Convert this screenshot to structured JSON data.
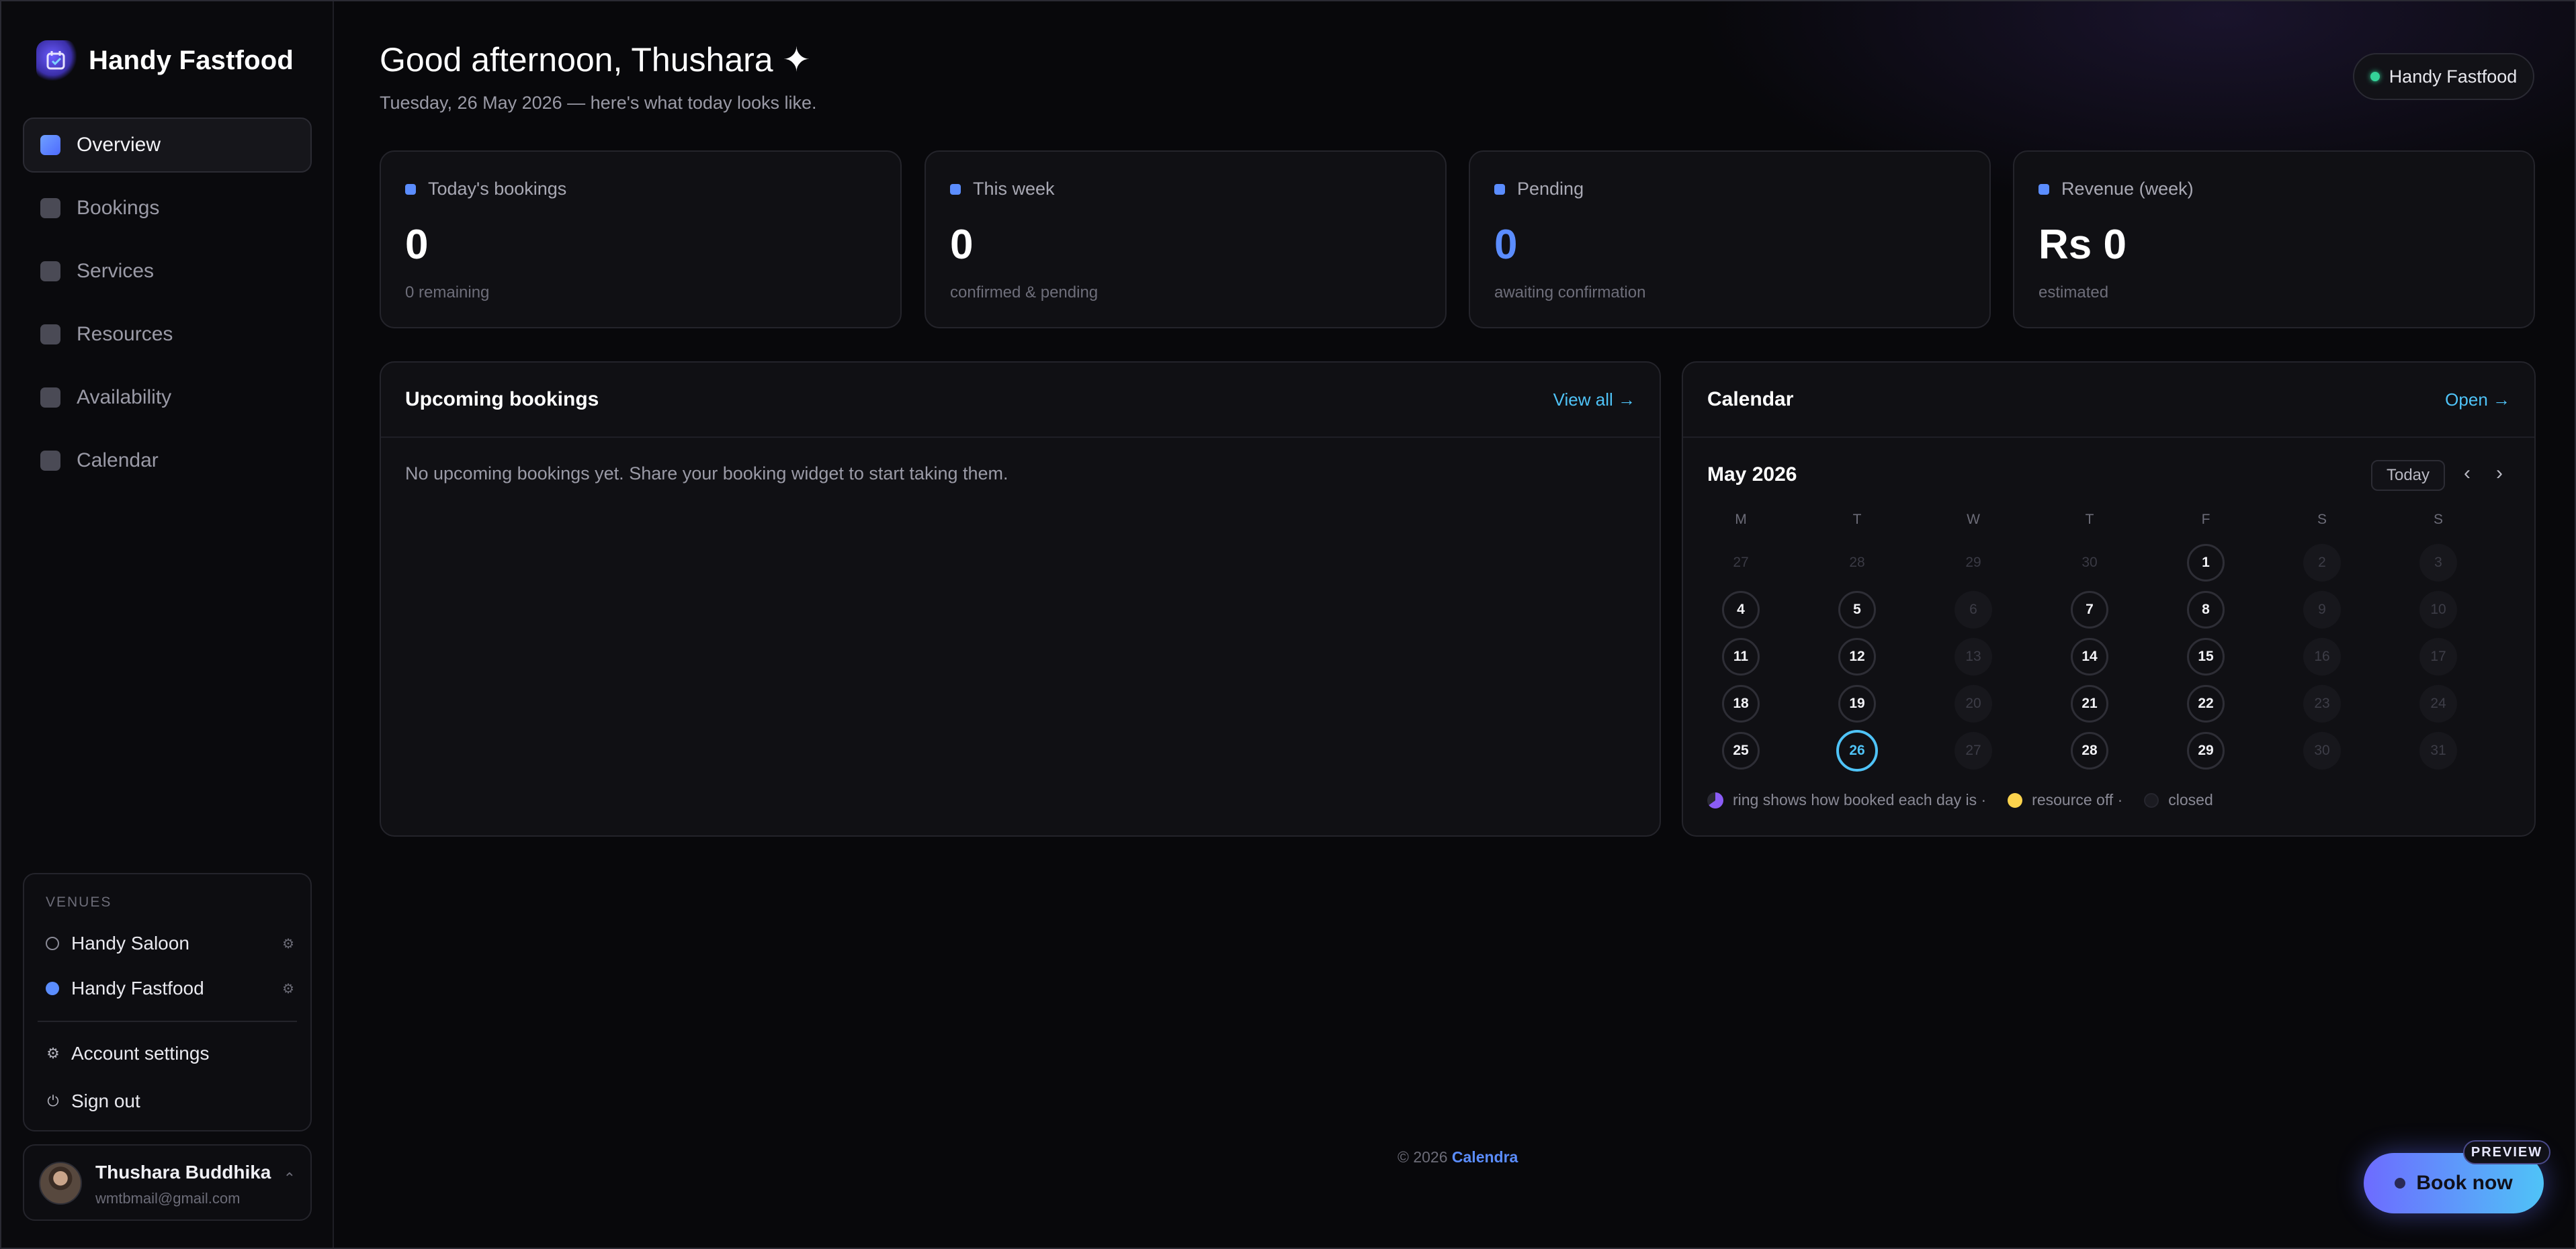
{
  "sidebar": {
    "brand": "Handy Fastfood",
    "nav": [
      {
        "label": "Overview"
      },
      {
        "label": "Bookings"
      },
      {
        "label": "Services"
      },
      {
        "label": "Resources"
      },
      {
        "label": "Availability"
      },
      {
        "label": "Calendar"
      }
    ],
    "venues_title": "VENUES",
    "venues": [
      {
        "label": "Handy Saloon"
      },
      {
        "label": "Handy Fastfood"
      }
    ],
    "account_settings": "Account settings",
    "sign_out": "Sign out",
    "user": {
      "name": "Thushara Buddhika",
      "email": "wmtbmail@gmail.com"
    }
  },
  "header": {
    "greeting": "Good afternoon, Thushara ✦",
    "subtitle": "Tuesday, 26 May 2026 — here's what today looks like.",
    "venue_pill": "Handy Fastfood"
  },
  "stats": [
    {
      "label": "Today's bookings",
      "value": "0",
      "sub": "0 remaining"
    },
    {
      "label": "This week",
      "value": "0",
      "sub": "confirmed & pending"
    },
    {
      "label": "Pending",
      "value": "0",
      "sub": "awaiting confirmation"
    },
    {
      "label": "Revenue (week)",
      "value": "Rs 0",
      "sub": "estimated"
    }
  ],
  "upcoming": {
    "title": "Upcoming bookings",
    "link": "View all →",
    "empty": "No upcoming bookings yet. Share your booking widget to start taking them."
  },
  "calendar": {
    "title": "Calendar",
    "link": "Open →",
    "month": "May 2026",
    "today_label": "Today",
    "prev": "‹",
    "next": "›",
    "weekdays": [
      "M",
      "T",
      "W",
      "T",
      "F",
      "S",
      "S"
    ],
    "weeks": [
      [
        "27",
        "28",
        "29",
        "30",
        "1",
        "2",
        "3"
      ],
      [
        "4",
        "5",
        "6",
        "7",
        "8",
        "9",
        "10"
      ],
      [
        "11",
        "12",
        "13",
        "14",
        "15",
        "16",
        "17"
      ],
      [
        "18",
        "19",
        "20",
        "21",
        "22",
        "23",
        "24"
      ],
      [
        "25",
        "26",
        "27",
        "28",
        "29",
        "30",
        "31"
      ]
    ],
    "legend": {
      "ring": "ring shows how booked each day is ·",
      "resource_off": "resource off ·",
      "closed": "closed"
    }
  },
  "footer": {
    "copyright": "© 2026",
    "brand": "Calendra"
  },
  "book_now": {
    "label": "Book now",
    "tag": "PREVIEW"
  },
  "colors": {
    "accent": "#5b8dff",
    "link": "#4fc3f7",
    "status_green": "#34d399"
  }
}
